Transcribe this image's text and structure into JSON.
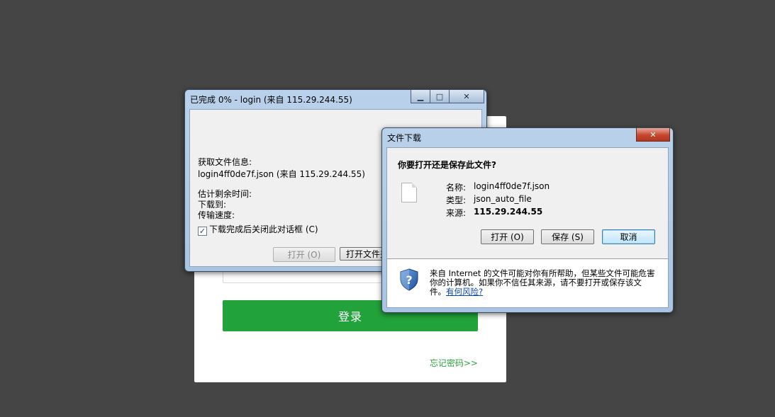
{
  "login": {
    "button_label": "登录",
    "forgot_link": "忘记密码>>"
  },
  "progress_window": {
    "title": "已完成 0% - login (来自 115.29.244.55)",
    "status_label": "获取文件信息:",
    "file_line": "login4ff0de7f.json (来自 115.29.244.55)",
    "time_left_label": "估计剩余时间:",
    "download_to_label": "下载到:",
    "speed_label": "传输速度:",
    "close_checkbox": {
      "label": "下载完成后关闭此对话框 (C)",
      "checked": true
    },
    "open_button": "打开 (O)",
    "open_folder_button": "打开文件夹"
  },
  "download_dialog": {
    "title": "文件下载",
    "question": "你要打开还是保存此文件?",
    "name_label": "名称:",
    "name_value": "login4ff0de7f.json",
    "type_label": "类型:",
    "type_value": "json_auto_file",
    "source_label": "来源:",
    "source_value": "115.29.244.55",
    "open_button": "打开 (O)",
    "save_button": "保存 (S)",
    "cancel_button": "取消",
    "warning_text": "来自 Internet 的文件可能对你有所帮助，但某些文件可能危害你的计算机。如果你不信任其来源，请不要打开或保存该文件。",
    "warning_link": "有何风险?"
  },
  "colors": {
    "desktop": "#454545",
    "login_green": "#22a23a",
    "link_green": "#2aa33c",
    "close_red": "#c6462e"
  }
}
